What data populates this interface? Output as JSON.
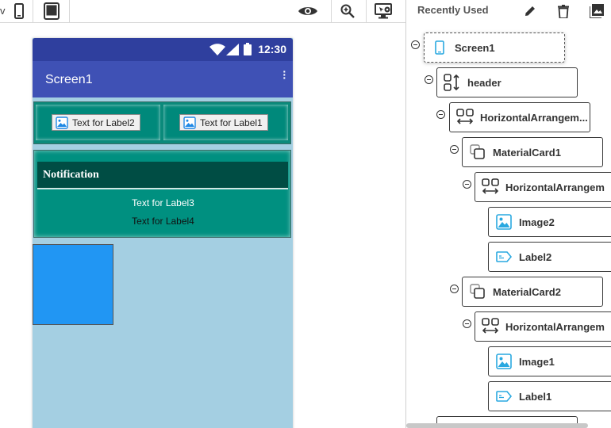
{
  "toolbar": {
    "cut_text": "v",
    "icons": [
      "phone-size-icon",
      "tablet-size-icon",
      "preview-eye-icon",
      "zoom-in-icon",
      "display-settings-icon"
    ]
  },
  "viewer": {
    "status_time": "12:30",
    "screen_title": "Screen1",
    "label2": "Text for Label2",
    "label1": "Text for Label1",
    "notification_title": "Notification",
    "label3": "Text for Label3",
    "label4": "Text for Label4",
    "colors": {
      "status_bar": "#2f3f9e",
      "app_bar": "#3f51b5",
      "screen_bg": "#a4cfe2",
      "card": "#00897b",
      "notification_bar": "#004d44",
      "blue_box": "#2196f3"
    }
  },
  "panel": {
    "title": "Recently Used",
    "action_icons": [
      "pencil-icon",
      "trash-icon",
      "image-icon"
    ],
    "tree": [
      {
        "label": "Screen1",
        "icon": "phone-icon",
        "selected": true
      },
      {
        "label": "header",
        "icon": "vertical-arrangement-icon"
      },
      {
        "label": "HorizontalArrangem...",
        "icon": "horizontal-arrangement-icon"
      },
      {
        "label": "MaterialCard1",
        "icon": "material-card-icon"
      },
      {
        "label": "HorizontalArrangem",
        "icon": "horizontal-arrangement-icon"
      },
      {
        "label": "Image2",
        "icon": "image-icon"
      },
      {
        "label": "Label2",
        "icon": "label-icon"
      },
      {
        "label": "MaterialCard2",
        "icon": "material-card-icon"
      },
      {
        "label": "HorizontalArrangem",
        "icon": "horizontal-arrangement-icon"
      },
      {
        "label": "Image1",
        "icon": "image-icon"
      },
      {
        "label": "Label1",
        "icon": "label-icon"
      }
    ]
  }
}
